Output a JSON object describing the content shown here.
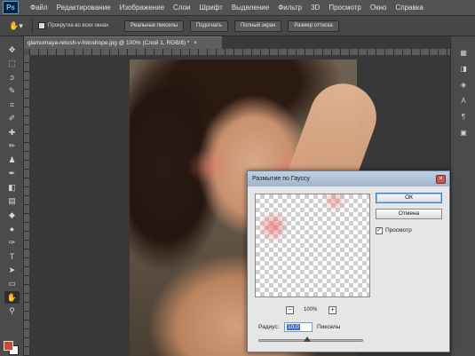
{
  "app": {
    "logo": "Ps"
  },
  "menu": {
    "items": [
      "Файл",
      "Редактирование",
      "Изображение",
      "Слои",
      "Шрифт",
      "Выделение",
      "Фильтр",
      "3D",
      "Просмотр",
      "Окно",
      "Справка"
    ]
  },
  "options_bar": {
    "tool_icon": "hand-icon",
    "scroll_all_label": "Прокрутка во всех окнах",
    "buttons": [
      "Реальные пикселы",
      "Подогнать",
      "Полный экран",
      "Размер оттиска"
    ]
  },
  "document": {
    "tab_title": "glamurnaya-retush-v-fotoshope.jpg @ 100% (Слой 1, RGB/8) *",
    "tab_close": "×"
  },
  "toolbar": {
    "tools": [
      {
        "name": "move-tool-icon",
        "glyph": "✥"
      },
      {
        "name": "marquee-tool-icon",
        "glyph": "⬚"
      },
      {
        "name": "lasso-tool-icon",
        "glyph": "ↄ"
      },
      {
        "name": "quick-select-tool-icon",
        "glyph": "✎"
      },
      {
        "name": "crop-tool-icon",
        "glyph": "⌗"
      },
      {
        "name": "eyedropper-tool-icon",
        "glyph": "✐"
      },
      {
        "name": "healing-brush-tool-icon",
        "glyph": "✚"
      },
      {
        "name": "brush-tool-icon",
        "glyph": "✏"
      },
      {
        "name": "clone-stamp-tool-icon",
        "glyph": "♟"
      },
      {
        "name": "history-brush-tool-icon",
        "glyph": "✒"
      },
      {
        "name": "eraser-tool-icon",
        "glyph": "◧"
      },
      {
        "name": "gradient-tool-icon",
        "glyph": "▤"
      },
      {
        "name": "blur-tool-icon",
        "glyph": "◆"
      },
      {
        "name": "dodge-tool-icon",
        "glyph": "●"
      },
      {
        "name": "pen-tool-icon",
        "glyph": "✑"
      },
      {
        "name": "type-tool-icon",
        "glyph": "T"
      },
      {
        "name": "path-select-tool-icon",
        "glyph": "➤"
      },
      {
        "name": "shape-tool-icon",
        "glyph": "▭"
      },
      {
        "name": "hand-tool-icon",
        "glyph": "✋"
      },
      {
        "name": "zoom-tool-icon",
        "glyph": "⚲"
      }
    ],
    "foreground_color": "#c74b3a",
    "background_color": "#ffffff"
  },
  "right_panel": {
    "icons": [
      {
        "name": "history-panel-icon",
        "glyph": "▦"
      },
      {
        "name": "adjustments-panel-icon",
        "glyph": "◨"
      },
      {
        "name": "layers-panel-icon",
        "glyph": "◈"
      },
      {
        "name": "character-panel-icon",
        "glyph": "A"
      },
      {
        "name": "paragraph-panel-icon",
        "glyph": "¶"
      },
      {
        "name": "swatches-panel-icon",
        "glyph": "▣"
      }
    ]
  },
  "dialog": {
    "title": "Размытие по Гауссу",
    "close_glyph": "×",
    "ok_label": "ОК",
    "cancel_label": "Отмена",
    "preview_check_glyph": "✓",
    "preview_label": "Просмотр",
    "zoom_out_glyph": "−",
    "zoom_in_glyph": "+",
    "zoom_level": "100%",
    "radius_label": "Радиус:",
    "radius_value": "10,0",
    "radius_units": "Пикселы",
    "radius_slider_fraction": 0.47,
    "preview_checked": true
  }
}
